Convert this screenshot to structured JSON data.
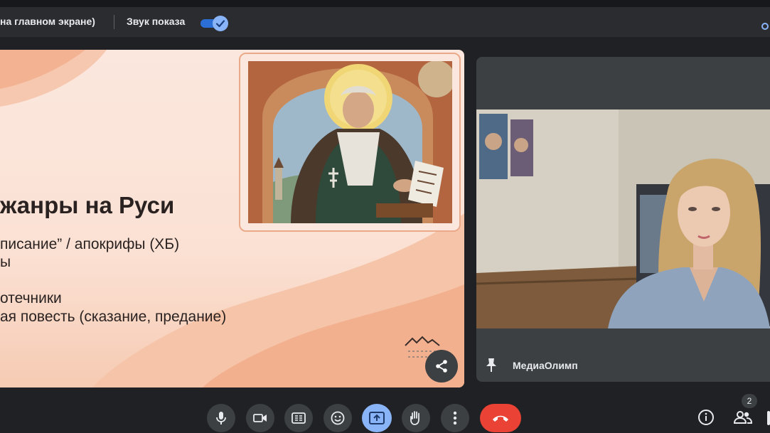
{
  "topbar": {
    "main_label": "на главном экране)",
    "sound_label": "Звук показа",
    "sound_toggle_on": true
  },
  "slide": {
    "title": "жанры на Руси",
    "lines": [
      "писание” / апокрифы (ХБ)",
      "ы",
      "отечники",
      "ая повесть (сказание, предание)"
    ]
  },
  "participant": {
    "name": "МедиаОлимп"
  },
  "controls": {
    "participants_count": "2",
    "accent": "#8ab4f8",
    "hangup_color": "#ea4335"
  },
  "icons": [
    "checkmark-icon",
    "share-icon",
    "pin-icon",
    "microphone-icon",
    "camera-icon",
    "captions-icon",
    "emoji-icon",
    "present-icon",
    "hand-icon",
    "more-icon",
    "hangup-icon",
    "info-icon",
    "people-icon"
  ]
}
